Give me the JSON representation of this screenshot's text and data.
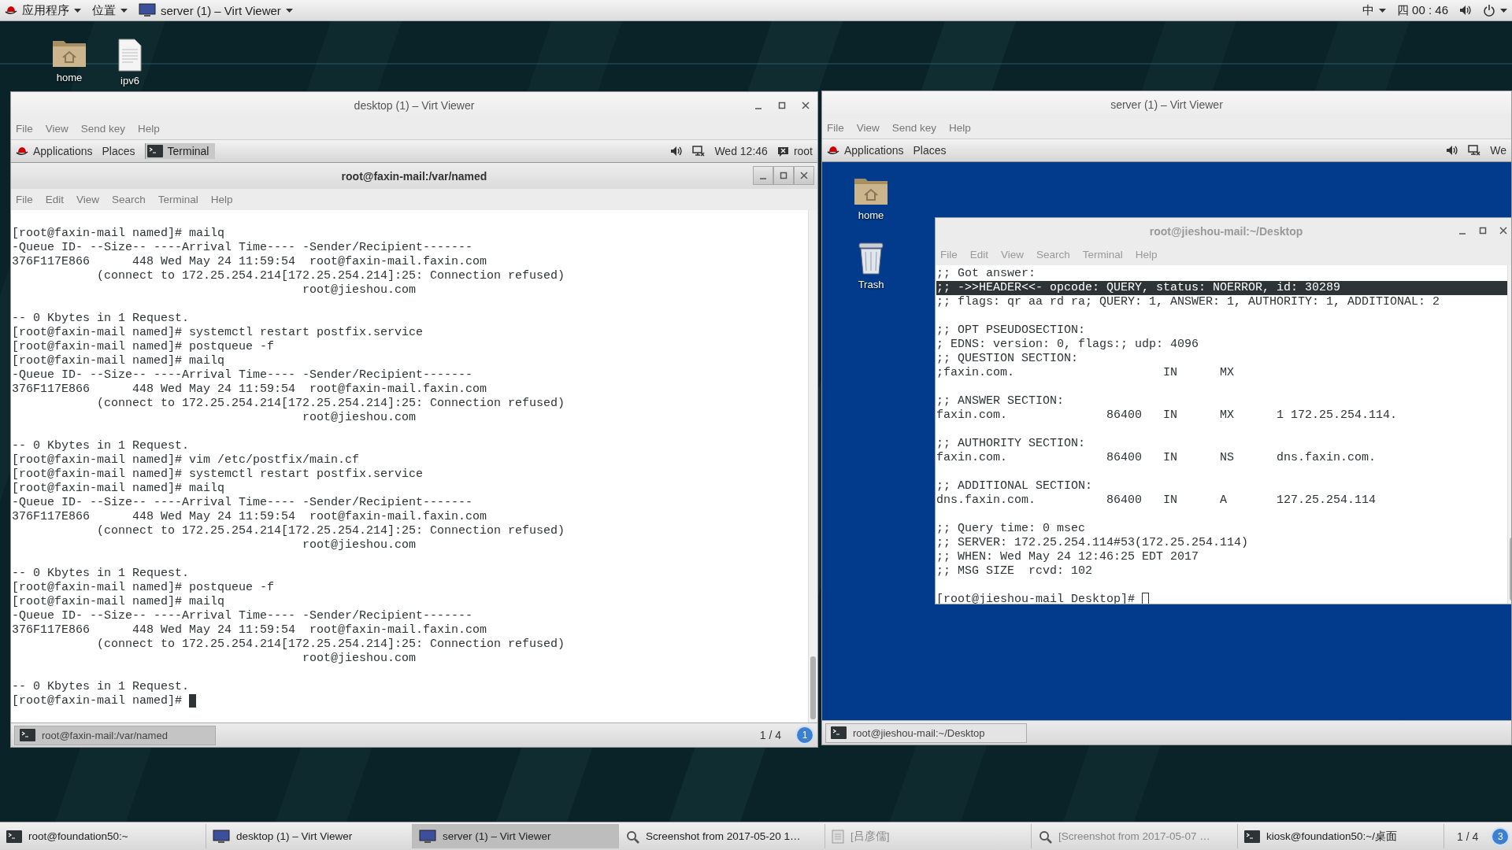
{
  "top_bar": {
    "menus": [
      {
        "label": "应用程序"
      },
      {
        "label": "位置"
      }
    ],
    "window_button": {
      "label": "server (1) – Virt Viewer"
    },
    "input_method": "中",
    "clock": "四 00 : 46"
  },
  "desktop_icons": [
    {
      "label": "home",
      "kind": "home-folder"
    },
    {
      "label": "ipv6",
      "kind": "file"
    }
  ],
  "windows": [
    {
      "title": "desktop (1) – Virt Viewer",
      "menu": [
        "File",
        "View",
        "Send key",
        "Help"
      ],
      "guest": {
        "panel": {
          "menus": [
            "Applications",
            "Places"
          ],
          "app": "Terminal",
          "clock": "Wed 12:46",
          "user": "root"
        },
        "terminal": {
          "title": "root@faxin-mail:/var/named",
          "focused": true,
          "menu": [
            "File",
            "Edit",
            "View",
            "Search",
            "Terminal",
            "Help"
          ],
          "blocks": [
            [
              "[root@faxin-mail named]# mailq",
              "-Queue ID- --Size-- ----Arrival Time---- -Sender/Recipient-------",
              "376F117E866      448 Wed May 24 11:59:54  root@faxin-mail.faxin.com",
              "            (connect to 172.25.254.214[172.25.254.214]:25: Connection refused)",
              "                                         root@jieshou.com"
            ],
            [
              "-- 0 Kbytes in 1 Request.",
              "[root@faxin-mail named]# systemctl restart postfix.service",
              "[root@faxin-mail named]# postqueue -f",
              "[root@faxin-mail named]# mailq",
              "-Queue ID- --Size-- ----Arrival Time---- -Sender/Recipient-------",
              "376F117E866      448 Wed May 24 11:59:54  root@faxin-mail.faxin.com",
              "            (connect to 172.25.254.214[172.25.254.214]:25: Connection refused)",
              "                                         root@jieshou.com"
            ],
            [
              "-- 0 Kbytes in 1 Request.",
              "[root@faxin-mail named]# vim /etc/postfix/main.cf",
              "[root@faxin-mail named]# systemctl restart postfix.service",
              "[root@faxin-mail named]# mailq",
              "-Queue ID- --Size-- ----Arrival Time---- -Sender/Recipient-------",
              "376F117E866      448 Wed May 24 11:59:54  root@faxin-mail.faxin.com",
              "            (connect to 172.25.254.214[172.25.254.214]:25: Connection refused)",
              "                                         root@jieshou.com"
            ],
            [
              "-- 0 Kbytes in 1 Request.",
              "[root@faxin-mail named]# postqueue -f",
              "[root@faxin-mail named]# mailq",
              "-Queue ID- --Size-- ----Arrival Time---- -Sender/Recipient-------",
              "376F117E866      448 Wed May 24 11:59:54  root@faxin-mail.faxin.com",
              "            (connect to 172.25.254.214[172.25.254.214]:25: Connection refused)",
              "                                         root@jieshou.com"
            ],
            [
              "-- 0 Kbytes in 1 Request.",
              "[root@faxin-mail named]#"
            ]
          ]
        },
        "taskbar": {
          "task": "root@faxin-mail:/var/named",
          "pager": "1 / 4",
          "badge": "1"
        }
      }
    },
    {
      "title": "server (1) – Virt Viewer",
      "menu": [
        "File",
        "View",
        "Send key",
        "Help"
      ],
      "guest": {
        "panel": {
          "menus": [
            "Applications",
            "Places"
          ],
          "clock": "We"
        },
        "desktop_icons": [
          {
            "label": "home",
            "kind": "home-folder"
          },
          {
            "label": "Trash",
            "kind": "trash"
          }
        ],
        "terminal": {
          "title": "root@jieshou-mail:~/Desktop",
          "focused": false,
          "menu": [
            "File",
            "Edit",
            "View",
            "Search",
            "Terminal",
            "Help"
          ],
          "blocks": [
            [
              {
                "text": ";; Got answer:",
                "selected": false
              },
              {
                "text": ";; ->>HEADER<<- opcode: QUERY, status: NOERROR, id: 30289",
                "selected": true
              },
              {
                "text": ";; flags: qr aa rd ra; QUERY: 1, ANSWER: 1, AUTHORITY: 1, ADDITIONAL: 2",
                "selected": false
              }
            ],
            [
              {
                "text": ";; OPT PSEUDOSECTION:",
                "selected": false
              },
              {
                "text": "; EDNS: version: 0, flags:; udp: 4096",
                "selected": false
              },
              {
                "text": ";; QUESTION SECTION:",
                "selected": false
              },
              {
                "text": ";faxin.com.                     IN      MX",
                "selected": false
              }
            ],
            [
              {
                "text": ";; ANSWER SECTION:",
                "selected": false
              },
              {
                "text": "faxin.com.              86400   IN      MX      1 172.25.254.114.",
                "selected": false
              }
            ],
            [
              {
                "text": ";; AUTHORITY SECTION:",
                "selected": false
              },
              {
                "text": "faxin.com.              86400   IN      NS      dns.faxin.com.",
                "selected": false
              }
            ],
            [
              {
                "text": ";; ADDITIONAL SECTION:",
                "selected": false
              },
              {
                "text": "dns.faxin.com.          86400   IN      A       127.25.254.114",
                "selected": false
              }
            ],
            [
              {
                "text": ";; Query time: 0 msec",
                "selected": false
              },
              {
                "text": ";; SERVER: 172.25.254.114#53(172.25.254.114)",
                "selected": false
              },
              {
                "text": ";; WHEN: Wed May 24 12:46:25 EDT 2017",
                "selected": false
              },
              {
                "text": ";; MSG SIZE  rcvd: 102",
                "selected": false
              }
            ],
            [
              {
                "text": "[root@jieshou-mail Desktop]#",
                "selected": false
              }
            ]
          ]
        },
        "taskbar": {
          "task": "root@jieshou-mail:~/Desktop"
        }
      }
    }
  ],
  "taskbar": {
    "items": [
      {
        "label": "root@foundation50:~",
        "kind": "terminal",
        "selected": false,
        "minimized": false
      },
      {
        "label": "desktop (1) – Virt Viewer",
        "kind": "viewer",
        "selected": false,
        "minimized": false
      },
      {
        "label": "server (1) – Virt Viewer",
        "kind": "viewer",
        "selected": true,
        "minimized": false
      },
      {
        "label": "Screenshot from 2017-05-20 1…",
        "kind": "screenshot",
        "selected": false,
        "minimized": false
      },
      {
        "label": "[吕彦儒]",
        "kind": "document",
        "selected": false,
        "minimized": true
      },
      {
        "label": "[Screenshot from 2017-05-07 …",
        "kind": "screenshot",
        "selected": false,
        "minimized": true
      },
      {
        "label": "kiosk@foundation50:~/桌面",
        "kind": "terminal",
        "selected": false,
        "minimized": false
      }
    ],
    "pager": "1 / 4",
    "badge": "3"
  }
}
